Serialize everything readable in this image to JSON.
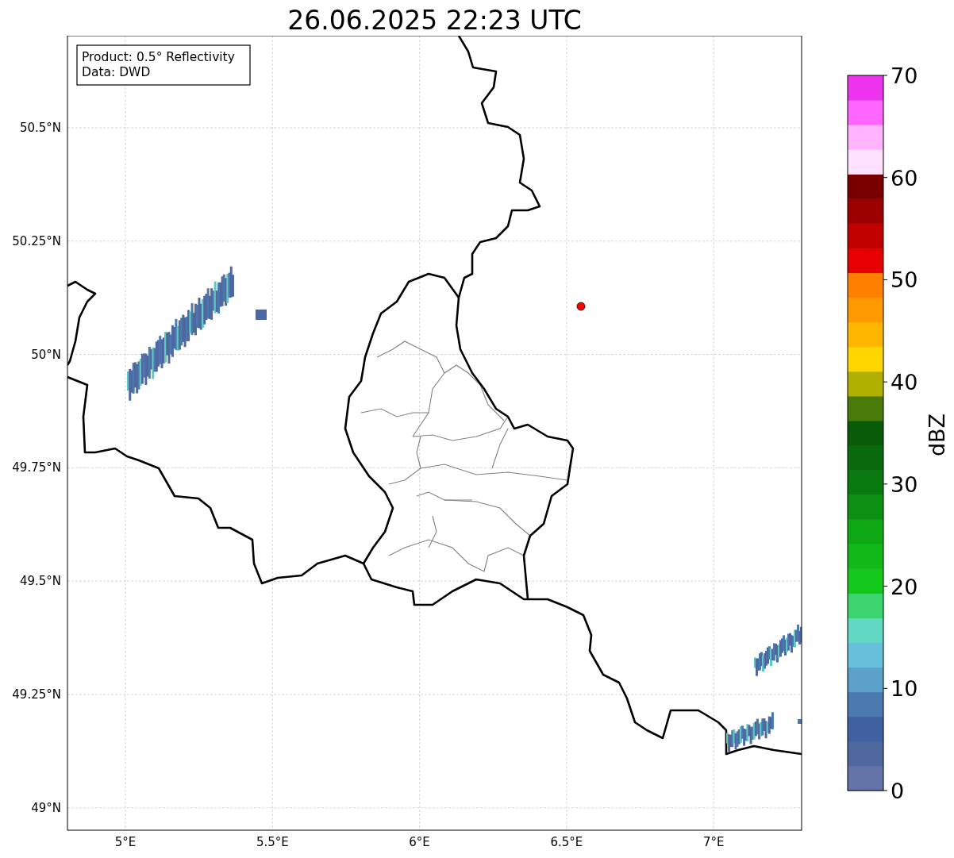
{
  "title": "26.06.2025 22:23 UTC",
  "info_box": {
    "lines": [
      "Product: 0.5° Reflectivity",
      "Data: DWD"
    ]
  },
  "map": {
    "lat_ticks": [
      "50.5°N",
      "50.25°N",
      "50°N",
      "49.75°N",
      "49.5°N",
      "49.25°N",
      "49°N"
    ],
    "lon_ticks": [
      "5°E",
      "5.5°E",
      "6°E",
      "6.5°E",
      "7°E"
    ]
  },
  "colorbar": {
    "label": "dBZ",
    "ticks": [
      "70",
      "60",
      "50",
      "40",
      "30",
      "20",
      "10",
      "0"
    ],
    "bands": [
      {
        "color": "#6474a8"
      },
      {
        "color": "#5068a0"
      },
      {
        "color": "#4060a0"
      },
      {
        "color": "#4a7ab0"
      },
      {
        "color": "#5aa0c8"
      },
      {
        "color": "#66c0dc"
      },
      {
        "color": "#60d8c4"
      },
      {
        "color": "#3cd46e"
      },
      {
        "color": "#12c81a"
      },
      {
        "color": "#10b818"
      },
      {
        "color": "#0ea814"
      },
      {
        "color": "#0c9012"
      },
      {
        "color": "#087a10"
      },
      {
        "color": "#086a0c"
      },
      {
        "color": "#085c08"
      },
      {
        "color": "#4a7a0a"
      },
      {
        "color": "#b0b000"
      },
      {
        "color": "#ffd700"
      },
      {
        "color": "#ffb600"
      },
      {
        "color": "#ff9900"
      },
      {
        "color": "#ff7f00"
      },
      {
        "color": "#e60000"
      },
      {
        "color": "#c20000"
      },
      {
        "color": "#9e0000"
      },
      {
        "color": "#7a0000"
      },
      {
        "color": "#ffe0ff"
      },
      {
        "color": "#ffb3ff"
      },
      {
        "color": "#ff66ff"
      },
      {
        "color": "#ee33ee"
      }
    ]
  }
}
